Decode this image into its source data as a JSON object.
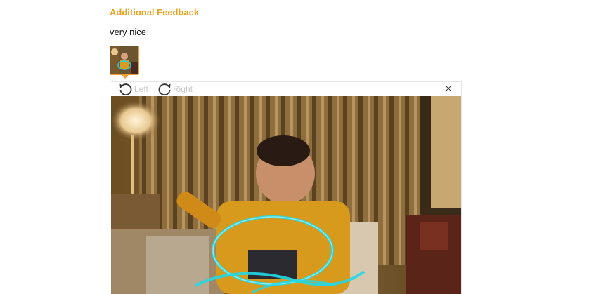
{
  "feedback": {
    "heading": "Additional Feedback",
    "text": "very nice",
    "heading_color": "#e8a21e",
    "thumbnail_border_color": "#f0a030"
  },
  "viewer": {
    "rotate_left_label": "Left",
    "rotate_right_label": "Right",
    "rotate_left_icon": "rotate-left-icon",
    "rotate_right_icon": "rotate-right-icon",
    "close_glyph": "×",
    "close_icon": "close-icon"
  }
}
